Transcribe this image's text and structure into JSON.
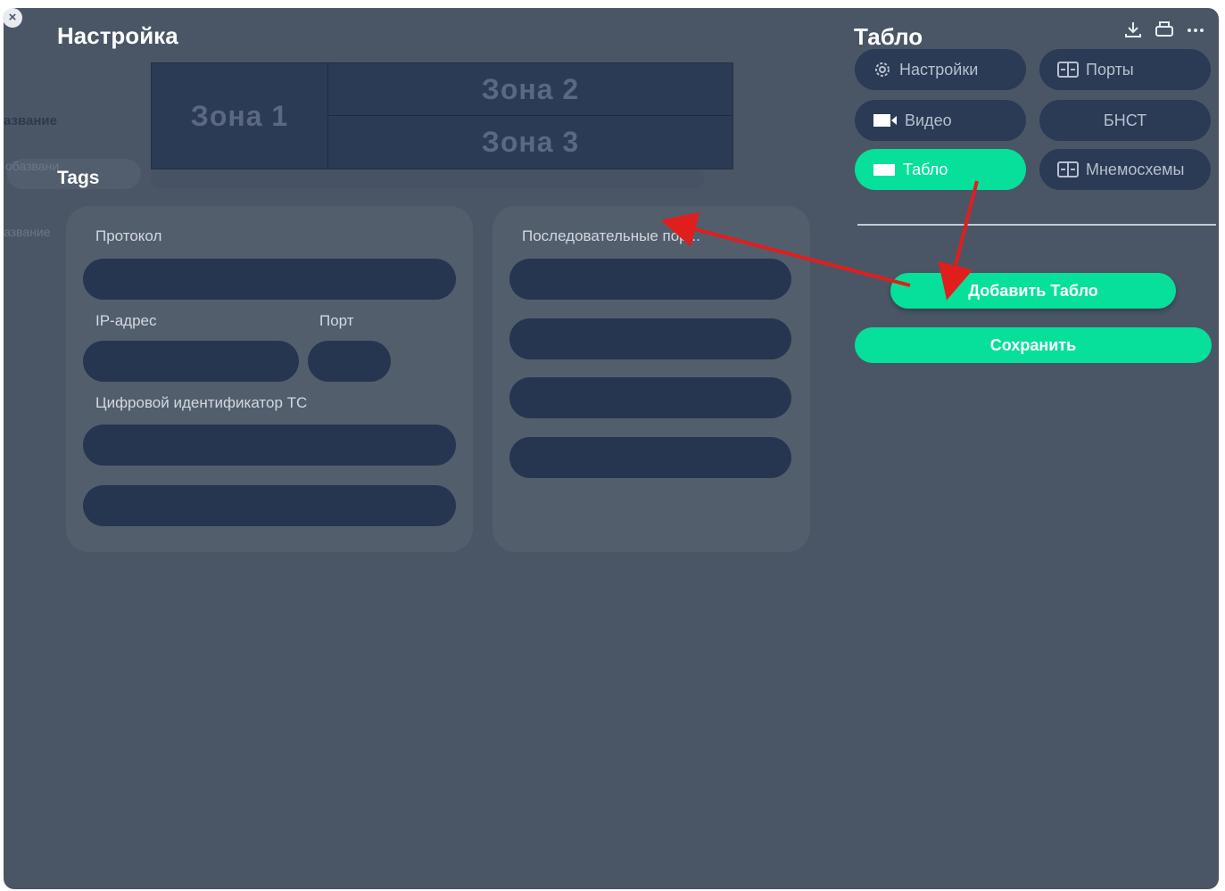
{
  "window": {
    "title": "Настройка",
    "close_label": "×"
  },
  "background": {
    "name_label": "азвание",
    "name_label_2": "азвание",
    "name_placeholder": "обазвани",
    "tags_label": "Tags"
  },
  "zones": {
    "zone1": "Зона 1",
    "zone2": "Зона 2",
    "zone3": "Зона 3"
  },
  "left_panel": {
    "protocol_label": "Протокол",
    "ip_label": "IP-адрес",
    "port_label": "Порт",
    "digital_id_label": "Цифровой идентификатор ТС"
  },
  "right_panel": {
    "serial_ports_label": "Последовательные пор..."
  },
  "sidebar": {
    "title": "Табло",
    "tabs": [
      {
        "label": "Настройки",
        "icon": "gear-icon"
      },
      {
        "label": "Порты",
        "icon": "port-icon"
      },
      {
        "label": "Видео",
        "icon": "video-icon"
      },
      {
        "label": "БНСТ",
        "icon": ""
      },
      {
        "label": "Табло",
        "icon": "display-icon",
        "active": true
      },
      {
        "label": "Мнемосхемы",
        "icon": "scheme-icon"
      }
    ],
    "add_button": "Добавить Табло",
    "save_button": "Сохранить"
  },
  "toolbar_icons": [
    "download-icon",
    "print-icon",
    "more-icon"
  ],
  "colors": {
    "background": "#4a5666",
    "field": "#263550",
    "accent": "#06e09a",
    "annotation": "#e01e1e"
  }
}
